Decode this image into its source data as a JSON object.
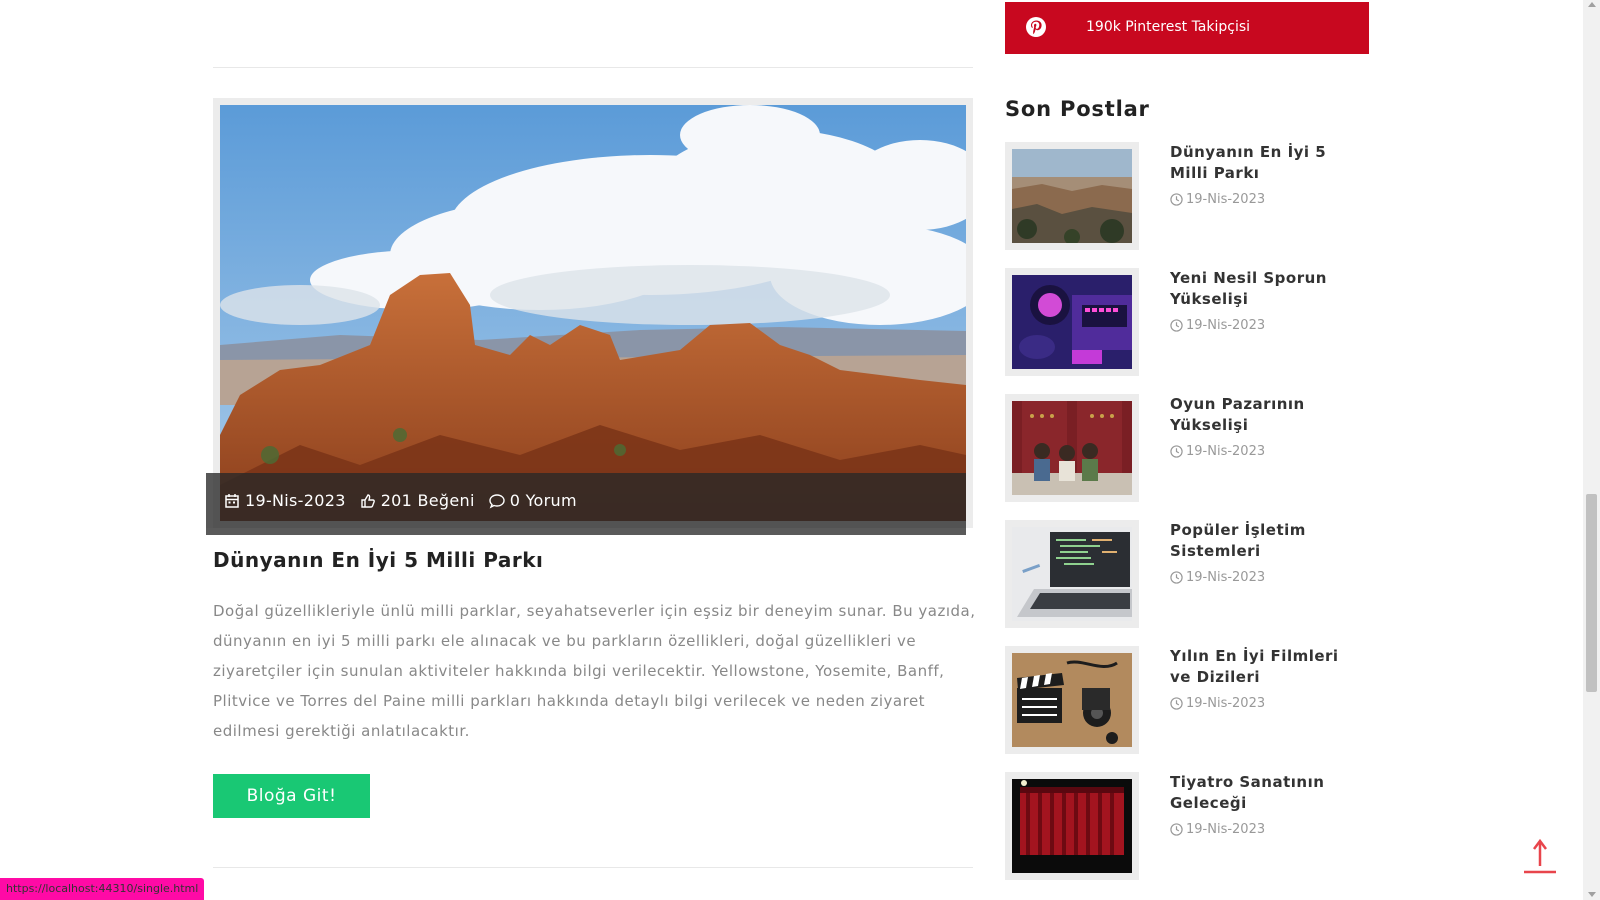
{
  "main_post": {
    "date": "19-Nis-2023",
    "likes": "201 Beğeni",
    "comments": "0 Yorum",
    "title": "Dünyanın En İyi 5 Milli Parkı",
    "excerpt": "Doğal güzellikleriyle ünlü milli parklar, seyahatseverler için eşsiz bir deneyim sunar. Bu yazıda, dünyanın en iyi 5 milli parkı ele alınacak ve bu parkların özellikleri, doğal güzellikleri ve ziyaretçiler için sunulan aktiviteler hakkında bilgi verilecektir. Yellowstone, Yosemite, Banff, Plitvice ve Torres del Paine milli parkları hakkında detaylı bilgi verilecek ve neden ziyaret edilmesi gerektiği anlatılacaktır.",
    "button_label": "Bloğa Git!",
    "image_icon": "canyon-photo"
  },
  "sidebar": {
    "pinterest_label": "190k Pinterest Takipçisi",
    "pinterest_icon": "pinterest-icon",
    "heading": "Son Postlar",
    "recent_posts": [
      {
        "title": "Dünyanın En İyi 5 Milli Parkı",
        "date": "19-Nis-2023",
        "thumb": "grand-canyon"
      },
      {
        "title": "Yeni Nesil Sporun Yükselişi",
        "date": "19-Nis-2023",
        "thumb": "esports-gear"
      },
      {
        "title": "Oyun Pazarının Yükselişi",
        "date": "19-Nis-2023",
        "thumb": "kids-gaming"
      },
      {
        "title": "Popüler İşletim Sistemleri",
        "date": "19-Nis-2023",
        "thumb": "laptop"
      },
      {
        "title": "Yılın En İyi Filmleri ve Dizileri",
        "date": "19-Nis-2023",
        "thumb": "film-clapper"
      },
      {
        "title": "Tiyatro Sanatının Geleceği",
        "date": "19-Nis-2023",
        "thumb": "theater-curtain"
      }
    ]
  },
  "status_bar": {
    "url": "https://localhost:44310/single.html"
  },
  "colors": {
    "pinterest": "#c8081f",
    "button": "#19c874",
    "back_to_top": "#e8454c"
  }
}
